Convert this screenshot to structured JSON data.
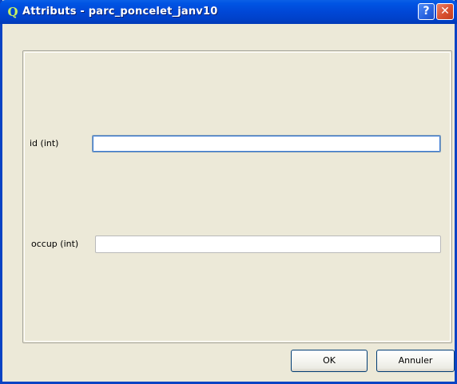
{
  "window": {
    "title": "Attributs - parc_poncelet_janv10",
    "icon_glyph": "Q",
    "help_glyph": "?",
    "close_glyph": "✕"
  },
  "form": {
    "fields": [
      {
        "label": "id (int)",
        "value": ""
      },
      {
        "label": "occup (int)",
        "value": ""
      }
    ]
  },
  "buttons": {
    "ok_label": "OK",
    "cancel_label": "Annuler"
  },
  "colors": {
    "titlebar": "#0054e3",
    "window_bg": "#ece9d8",
    "focus_border": "#3d7bd4"
  }
}
